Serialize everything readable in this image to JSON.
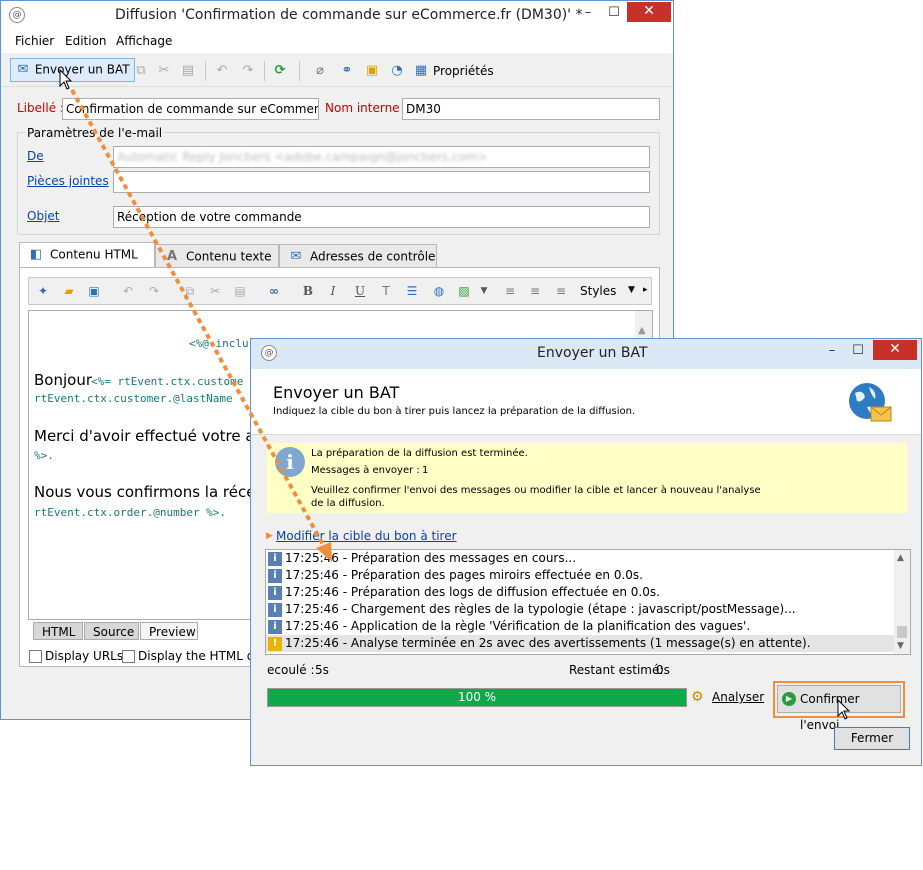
{
  "main_window": {
    "title": "Diffusion 'Confirmation de commande sur eCommerce.fr (DM30)' *",
    "app_icon": "app-icon",
    "menu": [
      "Fichier",
      "Edition",
      "Affichage"
    ],
    "toolbar": {
      "send_bat_label": "Envoyer un BAT",
      "properties_label": "Propriétés"
    },
    "libelle_label": "Libellé :",
    "libelle_value": "Confirmation de commande sur eCommerce.fr",
    "nom_interne_label": "Nom interne :",
    "nom_interne_value": "DM30",
    "email_params_legend": "Paramètres de l'e-mail",
    "de_label": "De",
    "de_value": "Automatic Reply Joncbers <adobe.campaign@joncbers.com>",
    "pieces_jointes_label": "Pièces jointes",
    "pieces_jointes_value": "",
    "objet_label": "Objet",
    "objet_value": "Réception de votre commande",
    "tabs": [
      "Contenu HTML",
      "Contenu texte",
      "Adresses de contrôle"
    ],
    "editor_toolbar": {
      "bold": "B",
      "italic": "I",
      "underline": "U",
      "styles": "Styles"
    },
    "editor": {
      "include_line": "<%@ inclu",
      "bonjour": "Bonjour",
      "code1": "<%= rtEvent.ctx.custome",
      "code2": "rtEvent.ctx.customer.@lastName",
      "merci": "Merci d'avoir effectué votre acha",
      "code3": "%>.",
      "nous": "Nous vous confirmons la récept",
      "code4": "rtEvent.ctx.order.@number %>."
    },
    "bottom_tabs": [
      "HTML",
      "Source",
      "Preview"
    ],
    "display_urls": "Display URLs",
    "display_html": "Display the HTML dia"
  },
  "dialog": {
    "title": "Envoyer un BAT",
    "heading": "Envoyer un BAT",
    "subheading": "Indiquez la cible du bon à tirer puis lancez la préparation de la diffusion.",
    "info_line1": "La préparation de la diffusion est terminée.",
    "info_messages_label": "Messages à envoyer :",
    "info_messages_value": "1",
    "info_line3": "Veuillez confirmer l'envoi des messages ou modifier la cible et lancer à nouveau l'analyse de la diffusion.",
    "modify_link": "Modifier la cible du bon à tirer",
    "log": [
      {
        "time": "17:25:46",
        "text": "- Préparation des messages en cours...",
        "level": "info"
      },
      {
        "time": "17:25:46",
        "text": "- Préparation des pages miroirs effectuée en 0.0s.",
        "level": "info"
      },
      {
        "time": "17:25:46",
        "text": "- Préparation des logs de diffusion effectuée en 0.0s.",
        "level": "info"
      },
      {
        "time": "17:25:46",
        "text": "- Chargement des règles de la typologie (étape : javascript/postMessage)...",
        "level": "info"
      },
      {
        "time": "17:25:46",
        "text": "- Application de la règle 'Vérification de la planification des vagues'.",
        "level": "info"
      },
      {
        "time": "17:25:46",
        "text": "- Analyse terminée en 2s avec des avertissements (1 message(s) en attente).",
        "level": "warning"
      }
    ],
    "elapsed_label": "ecoulé :",
    "elapsed_value": "5s",
    "remaining_label": "Restant estimé:",
    "remaining_value": "0s",
    "progress_text": "100 %",
    "progress_value": 1.0,
    "analyse_label": "Analyser",
    "confirm_label": "Confirmer l'envoi",
    "close_label": "Fermer"
  },
  "colors": {
    "accent": "#f28e3a",
    "progress": "#0fa84b",
    "title_border": "#5a95d6",
    "label_red": "#cc0000"
  }
}
